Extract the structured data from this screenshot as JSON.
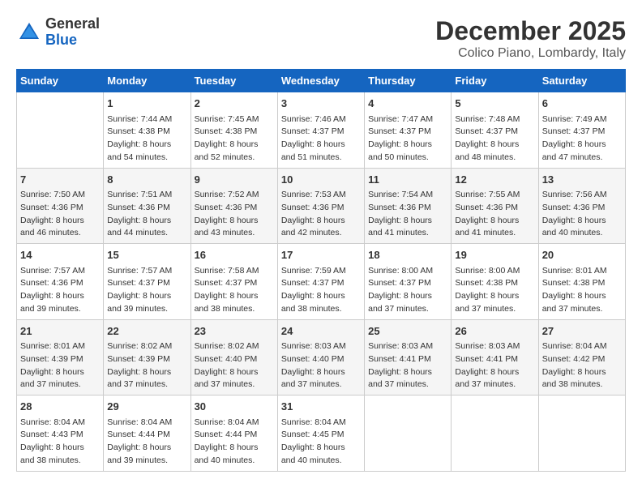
{
  "logo": {
    "general": "General",
    "blue": "Blue"
  },
  "title": "December 2025",
  "location": "Colico Piano, Lombardy, Italy",
  "days_of_week": [
    "Sunday",
    "Monday",
    "Tuesday",
    "Wednesday",
    "Thursday",
    "Friday",
    "Saturday"
  ],
  "weeks": [
    [
      {
        "day": "",
        "empty": true
      },
      {
        "day": "1",
        "sunrise": "Sunrise: 7:44 AM",
        "sunset": "Sunset: 4:38 PM",
        "daylight": "Daylight: 8 hours and 54 minutes."
      },
      {
        "day": "2",
        "sunrise": "Sunrise: 7:45 AM",
        "sunset": "Sunset: 4:38 PM",
        "daylight": "Daylight: 8 hours and 52 minutes."
      },
      {
        "day": "3",
        "sunrise": "Sunrise: 7:46 AM",
        "sunset": "Sunset: 4:37 PM",
        "daylight": "Daylight: 8 hours and 51 minutes."
      },
      {
        "day": "4",
        "sunrise": "Sunrise: 7:47 AM",
        "sunset": "Sunset: 4:37 PM",
        "daylight": "Daylight: 8 hours and 50 minutes."
      },
      {
        "day": "5",
        "sunrise": "Sunrise: 7:48 AM",
        "sunset": "Sunset: 4:37 PM",
        "daylight": "Daylight: 8 hours and 48 minutes."
      },
      {
        "day": "6",
        "sunrise": "Sunrise: 7:49 AM",
        "sunset": "Sunset: 4:37 PM",
        "daylight": "Daylight: 8 hours and 47 minutes."
      }
    ],
    [
      {
        "day": "7",
        "sunrise": "Sunrise: 7:50 AM",
        "sunset": "Sunset: 4:36 PM",
        "daylight": "Daylight: 8 hours and 46 minutes."
      },
      {
        "day": "8",
        "sunrise": "Sunrise: 7:51 AM",
        "sunset": "Sunset: 4:36 PM",
        "daylight": "Daylight: 8 hours and 44 minutes."
      },
      {
        "day": "9",
        "sunrise": "Sunrise: 7:52 AM",
        "sunset": "Sunset: 4:36 PM",
        "daylight": "Daylight: 8 hours and 43 minutes."
      },
      {
        "day": "10",
        "sunrise": "Sunrise: 7:53 AM",
        "sunset": "Sunset: 4:36 PM",
        "daylight": "Daylight: 8 hours and 42 minutes."
      },
      {
        "day": "11",
        "sunrise": "Sunrise: 7:54 AM",
        "sunset": "Sunset: 4:36 PM",
        "daylight": "Daylight: 8 hours and 41 minutes."
      },
      {
        "day": "12",
        "sunrise": "Sunrise: 7:55 AM",
        "sunset": "Sunset: 4:36 PM",
        "daylight": "Daylight: 8 hours and 41 minutes."
      },
      {
        "day": "13",
        "sunrise": "Sunrise: 7:56 AM",
        "sunset": "Sunset: 4:36 PM",
        "daylight": "Daylight: 8 hours and 40 minutes."
      }
    ],
    [
      {
        "day": "14",
        "sunrise": "Sunrise: 7:57 AM",
        "sunset": "Sunset: 4:36 PM",
        "daylight": "Daylight: 8 hours and 39 minutes."
      },
      {
        "day": "15",
        "sunrise": "Sunrise: 7:57 AM",
        "sunset": "Sunset: 4:37 PM",
        "daylight": "Daylight: 8 hours and 39 minutes."
      },
      {
        "day": "16",
        "sunrise": "Sunrise: 7:58 AM",
        "sunset": "Sunset: 4:37 PM",
        "daylight": "Daylight: 8 hours and 38 minutes."
      },
      {
        "day": "17",
        "sunrise": "Sunrise: 7:59 AM",
        "sunset": "Sunset: 4:37 PM",
        "daylight": "Daylight: 8 hours and 38 minutes."
      },
      {
        "day": "18",
        "sunrise": "Sunrise: 8:00 AM",
        "sunset": "Sunset: 4:37 PM",
        "daylight": "Daylight: 8 hours and 37 minutes."
      },
      {
        "day": "19",
        "sunrise": "Sunrise: 8:00 AM",
        "sunset": "Sunset: 4:38 PM",
        "daylight": "Daylight: 8 hours and 37 minutes."
      },
      {
        "day": "20",
        "sunrise": "Sunrise: 8:01 AM",
        "sunset": "Sunset: 4:38 PM",
        "daylight": "Daylight: 8 hours and 37 minutes."
      }
    ],
    [
      {
        "day": "21",
        "sunrise": "Sunrise: 8:01 AM",
        "sunset": "Sunset: 4:39 PM",
        "daylight": "Daylight: 8 hours and 37 minutes."
      },
      {
        "day": "22",
        "sunrise": "Sunrise: 8:02 AM",
        "sunset": "Sunset: 4:39 PM",
        "daylight": "Daylight: 8 hours and 37 minutes."
      },
      {
        "day": "23",
        "sunrise": "Sunrise: 8:02 AM",
        "sunset": "Sunset: 4:40 PM",
        "daylight": "Daylight: 8 hours and 37 minutes."
      },
      {
        "day": "24",
        "sunrise": "Sunrise: 8:03 AM",
        "sunset": "Sunset: 4:40 PM",
        "daylight": "Daylight: 8 hours and 37 minutes."
      },
      {
        "day": "25",
        "sunrise": "Sunrise: 8:03 AM",
        "sunset": "Sunset: 4:41 PM",
        "daylight": "Daylight: 8 hours and 37 minutes."
      },
      {
        "day": "26",
        "sunrise": "Sunrise: 8:03 AM",
        "sunset": "Sunset: 4:41 PM",
        "daylight": "Daylight: 8 hours and 37 minutes."
      },
      {
        "day": "27",
        "sunrise": "Sunrise: 8:04 AM",
        "sunset": "Sunset: 4:42 PM",
        "daylight": "Daylight: 8 hours and 38 minutes."
      }
    ],
    [
      {
        "day": "28",
        "sunrise": "Sunrise: 8:04 AM",
        "sunset": "Sunset: 4:43 PM",
        "daylight": "Daylight: 8 hours and 38 minutes."
      },
      {
        "day": "29",
        "sunrise": "Sunrise: 8:04 AM",
        "sunset": "Sunset: 4:44 PM",
        "daylight": "Daylight: 8 hours and 39 minutes."
      },
      {
        "day": "30",
        "sunrise": "Sunrise: 8:04 AM",
        "sunset": "Sunset: 4:44 PM",
        "daylight": "Daylight: 8 hours and 40 minutes."
      },
      {
        "day": "31",
        "sunrise": "Sunrise: 8:04 AM",
        "sunset": "Sunset: 4:45 PM",
        "daylight": "Daylight: 8 hours and 40 minutes."
      },
      {
        "day": "",
        "empty": true
      },
      {
        "day": "",
        "empty": true
      },
      {
        "day": "",
        "empty": true
      }
    ]
  ]
}
